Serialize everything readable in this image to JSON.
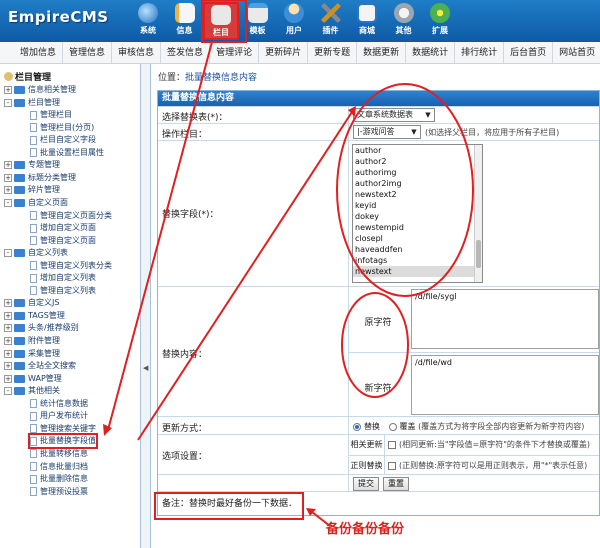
{
  "header": {
    "logo": "EmpireCMS",
    "nav": [
      {
        "label": "系统",
        "icon": "globe-icon"
      },
      {
        "label": "信息",
        "icon": "document-icon"
      },
      {
        "label": "栏目",
        "icon": "folder-icon",
        "active": true
      },
      {
        "label": "模板",
        "icon": "template-icon"
      },
      {
        "label": "用户",
        "icon": "user-icon"
      },
      {
        "label": "插件",
        "icon": "tools-icon"
      },
      {
        "label": "商城",
        "icon": "shop-icon"
      },
      {
        "label": "其他",
        "icon": "gear-icon"
      },
      {
        "label": "扩展",
        "icon": "plus-icon"
      }
    ]
  },
  "menubar": [
    "增加信息",
    "管理信息",
    "审核信息",
    "签发信息",
    "管理评论",
    "更新碎片",
    "更新专题",
    "数据更新",
    "数据统计",
    "排行统计",
    "后台首页",
    "网站首页"
  ],
  "sidebar": {
    "root": "栏目管理",
    "items": [
      {
        "label": "信息相关管理",
        "level": 0,
        "type": "folder",
        "exp": "+"
      },
      {
        "label": "栏目管理",
        "level": 0,
        "type": "folder",
        "exp": "-"
      },
      {
        "label": "管理栏目",
        "level": 1,
        "type": "doc"
      },
      {
        "label": "管理栏目(分页)",
        "level": 1,
        "type": "doc"
      },
      {
        "label": "栏目自定义字段",
        "level": 1,
        "type": "doc"
      },
      {
        "label": "批量设置栏目属性",
        "level": 1,
        "type": "doc"
      },
      {
        "label": "专题管理",
        "level": 0,
        "type": "folder",
        "exp": "+"
      },
      {
        "label": "标题分类管理",
        "level": 0,
        "type": "folder",
        "exp": "+"
      },
      {
        "label": "碎片管理",
        "level": 0,
        "type": "folder",
        "exp": "+"
      },
      {
        "label": "自定义页面",
        "level": 0,
        "type": "folder",
        "exp": "-"
      },
      {
        "label": "管理自定义页面分类",
        "level": 1,
        "type": "doc"
      },
      {
        "label": "增加自定义页面",
        "level": 1,
        "type": "doc"
      },
      {
        "label": "管理自定义页面",
        "level": 1,
        "type": "doc"
      },
      {
        "label": "自定义列表",
        "level": 0,
        "type": "folder",
        "exp": "-"
      },
      {
        "label": "管理自定义列表分类",
        "level": 1,
        "type": "doc"
      },
      {
        "label": "增加自定义列表",
        "level": 1,
        "type": "doc"
      },
      {
        "label": "管理自定义列表",
        "level": 1,
        "type": "doc"
      },
      {
        "label": "自定义JS",
        "level": 0,
        "type": "folder",
        "exp": "+"
      },
      {
        "label": "TAGS管理",
        "level": 0,
        "type": "folder",
        "exp": "+"
      },
      {
        "label": "头条/推荐级别",
        "level": 0,
        "type": "folder",
        "exp": "+"
      },
      {
        "label": "附件管理",
        "level": 0,
        "type": "folder",
        "exp": "+"
      },
      {
        "label": "采集管理",
        "level": 0,
        "type": "folder",
        "exp": "+"
      },
      {
        "label": "全站全文搜索",
        "level": 0,
        "type": "folder",
        "exp": "+"
      },
      {
        "label": "WAP管理",
        "level": 0,
        "type": "folder",
        "exp": "+"
      },
      {
        "label": "其他相关",
        "level": 0,
        "type": "folder",
        "exp": "-"
      },
      {
        "label": "统计信息数据",
        "level": 1,
        "type": "doc"
      },
      {
        "label": "用户发布统计",
        "level": 1,
        "type": "doc"
      },
      {
        "label": "管理搜索关键字",
        "level": 1,
        "type": "doc"
      },
      {
        "label": "批量替换字段值",
        "level": 1,
        "type": "doc",
        "highlight": true
      },
      {
        "label": "批量转移信息",
        "level": 1,
        "type": "doc"
      },
      {
        "label": "信息批量归档",
        "level": 1,
        "type": "doc"
      },
      {
        "label": "批量删除信息",
        "level": 1,
        "type": "doc"
      },
      {
        "label": "管理预设投票",
        "level": 1,
        "type": "doc"
      }
    ]
  },
  "splitter": "◀",
  "content": {
    "breadcrumb_prefix": "位置：",
    "breadcrumb_link": "批量替换信息内容",
    "form_title": "批量替换信息内容",
    "table_label": "选择替换表(*)：",
    "table_value": "文章系统数据表",
    "column_label": "操作栏目：",
    "column_value": "|-游戏问答",
    "column_hint": "(如选择父栏目，将应用于所有子栏目)",
    "field_label": "替换字段(*)：",
    "field_options": [
      "author",
      "author2",
      "authorimg",
      "author2img",
      "newstext2",
      "keyid",
      "dokey",
      "newstempid",
      "closepl",
      "haveaddfen",
      "infotags",
      "newstext"
    ],
    "field_selected": "newstext",
    "content_label": "替换内容：",
    "original_label": "原字符",
    "original_value": "/d/file/sygl",
    "new_label": "新字符",
    "new_value": "/d/file/wd",
    "mode_label": "更新方式：",
    "mode_replace": "替换",
    "mode_overwrite": "覆盖",
    "mode_hint": "(覆盖方式为将字段全部内容更新为新字符内容)",
    "options_label": "选项设置：",
    "option_related_label": "相关更新",
    "option_related_hint": "(相同更新:当\"字段值=原字符\"的条件下才替换或覆盖)",
    "option_regex_label": "正则替换",
    "option_regex_hint": "(正则替换:原字符可以是用正则表示，用\"*\"表示任意)",
    "submit": "提交",
    "reset": "重置",
    "note": "备注：替换时最好备份一下数据．"
  },
  "annotation": "备份备份备份",
  "colors": {
    "accent": "#1565b5",
    "annotation": "#e02020"
  }
}
